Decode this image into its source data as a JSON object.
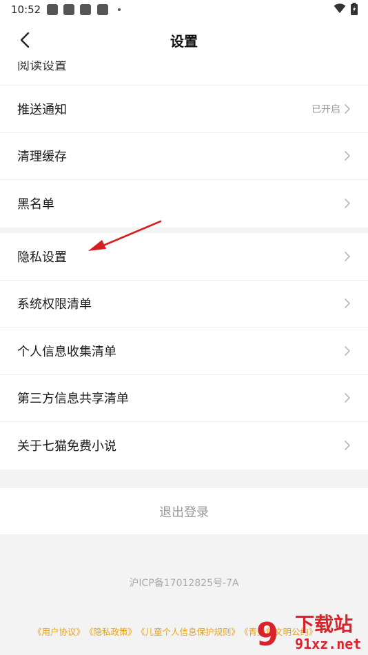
{
  "status_bar": {
    "time": "10:52"
  },
  "header": {
    "title": "设置"
  },
  "settings": {
    "partial_item": "阅读设置",
    "group1": [
      {
        "label": "推送通知",
        "value": "已开启"
      },
      {
        "label": "清理缓存",
        "value": ""
      },
      {
        "label": "黑名单",
        "value": ""
      }
    ],
    "group2": [
      {
        "label": "隐私设置"
      },
      {
        "label": "系统权限清单"
      },
      {
        "label": "个人信息收集清单"
      },
      {
        "label": "第三方信息共享清单"
      },
      {
        "label": "关于七猫免费小说"
      }
    ]
  },
  "logout_label": "退出登录",
  "icp": "沪ICP备17012825号-7A",
  "footer_links": [
    "《用户协议》",
    "《隐私政策》",
    "《儿童个人信息保护规则》",
    "《青少年文明公约》"
  ],
  "watermark": {
    "number": "9",
    "title": "下载站",
    "domain": "91xz.net"
  },
  "colors": {
    "link": "#e8a317",
    "annotation_arrow": "#d42020",
    "watermark": "#d9232a"
  }
}
